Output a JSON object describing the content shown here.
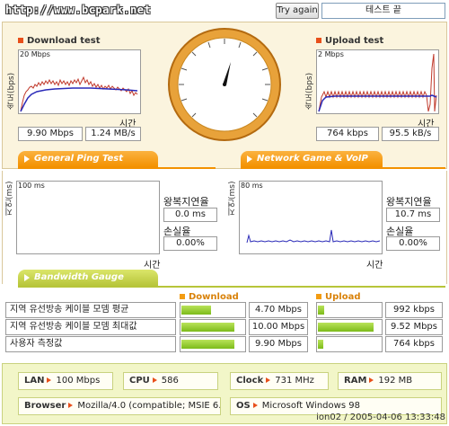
{
  "site": "http://www.bcpark.net",
  "header": {
    "try_again": "Try again",
    "status": "테스트 끝"
  },
  "download": {
    "title": "Download test",
    "ylabel": "속도(bps)",
    "scale": "20 Mbps",
    "xlabel": "시간",
    "mbps": "9.90 Mbps",
    "mbytes": "1.24 MB/s"
  },
  "upload": {
    "title": "Upload test",
    "ylabel": "속도(bps)",
    "scale": "2 Mbps",
    "xlabel": "시간",
    "kbps": "764 kbps",
    "kbytes": "95.5 kB/s"
  },
  "tabs": {
    "ping": "General Ping Test",
    "network": "Network Game & VoIP Test",
    "gauge": "Bandwidth Gauge"
  },
  "ping": {
    "ylabel": "지연(ms)",
    "scale": "100 ms",
    "xlabel": "시간",
    "rtt_label": "왕복지연율",
    "rtt_value": "0.0 ms",
    "loss_label": "손실율",
    "loss_value": "0.00%"
  },
  "network": {
    "ylabel": "지연(ms)",
    "scale": "80 ms",
    "xlabel": "시간",
    "rtt_label": "왕복지연율",
    "rtt_value": "10.7 ms",
    "loss_label": "손실율",
    "loss_value": "0.00%"
  },
  "gauge": {
    "download_header": "Download",
    "upload_header": "Upload",
    "rows": [
      {
        "label": "지역 유선방송 케이블 모뎀 평균",
        "down": "4.70 Mbps",
        "down_fill": 0.47,
        "up": "992 kbps",
        "up_fill": 0.1
      },
      {
        "label": "지역 유선방송 케이블 모뎀 최대값",
        "down": "10.00 Mbps",
        "down_fill": 0.84,
        "up": "9.52 Mbps",
        "up_fill": 0.88
      },
      {
        "label": "사용자 측정값",
        "down": "9.90 Mbps",
        "down_fill": 0.84,
        "up": "764 kbps",
        "up_fill": 0.08
      }
    ]
  },
  "sysinfo": {
    "lan_label": "LAN",
    "lan": "100 Mbps",
    "cpu_label": "CPU",
    "cpu": "586",
    "clock_label": "Clock",
    "clock": "731 MHz",
    "ram_label": "RAM",
    "ram": "192 MB",
    "browser_label": "Browser",
    "browser": "Mozilla/4.0 (compatible; MSIE 6.0",
    "os_label": "OS",
    "os": "Microsoft Windows 98"
  },
  "stamp": "ion02 / 2005-04-06 13:33:48",
  "colors": {
    "accent": "#f39100",
    "download_line": "#c0392b",
    "avg_line": "#2a2ab8",
    "gauge_fill": "#7cbb1a"
  }
}
